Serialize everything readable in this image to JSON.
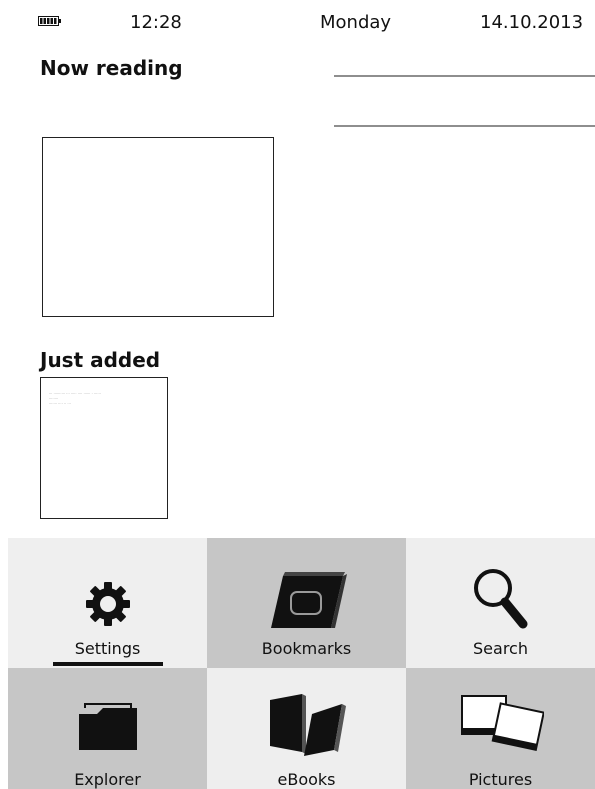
{
  "status": {
    "time": "12:28",
    "day": "Monday",
    "date": "14.10.2013"
  },
  "sections": {
    "now_reading": "Now reading",
    "just_added": "Just added"
  },
  "just_added_preview": {
    "lines": [
      "... .......... ... ..... .... ...... . ......",
      "........",
      "....... .... .. ..."
    ]
  },
  "menu": {
    "settings": "Settings",
    "bookmarks": "Bookmarks",
    "search": "Search",
    "explorer": "Explorer",
    "ebooks": "eBooks",
    "pictures": "Pictures"
  },
  "icons": {
    "battery": "battery-icon",
    "settings": "gear-icon",
    "bookmarks": "book-icon",
    "search": "magnifier-icon",
    "explorer": "folder-icon",
    "ebooks": "books-icon",
    "pictures": "pictures-icon"
  },
  "colors": {
    "tile_light": "#eeeeee",
    "tile_dark": "#c6c6c6",
    "icon_dark": "#111111"
  }
}
